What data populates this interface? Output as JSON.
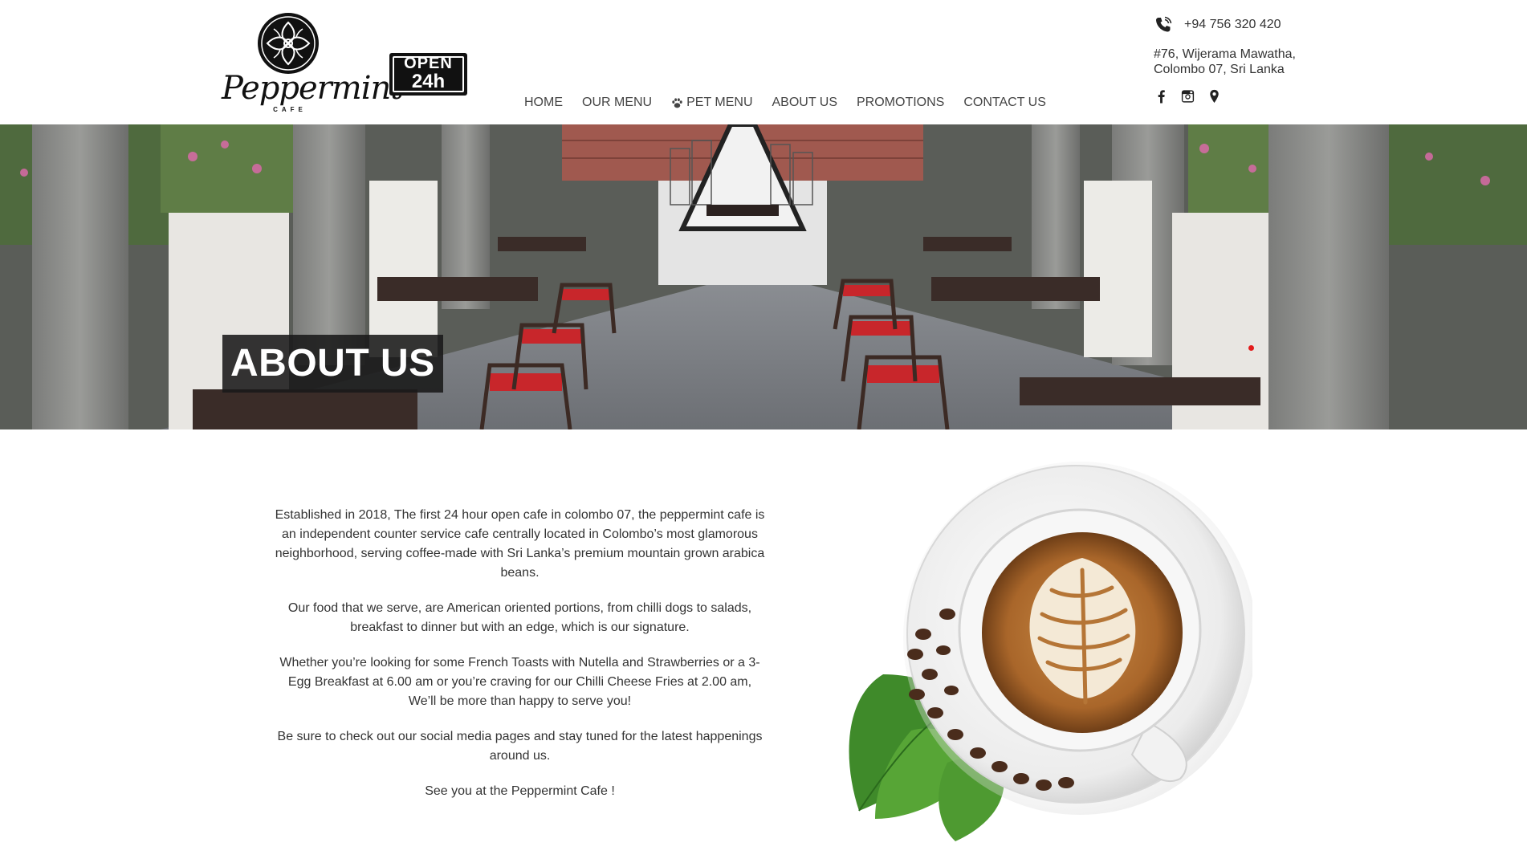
{
  "brand": {
    "name": "Peppermint",
    "subtitle": "CAFE",
    "badge_line1": "OPEN",
    "badge_line2": "24h"
  },
  "nav": {
    "items": [
      {
        "label": "HOME",
        "icon": null
      },
      {
        "label": "OUR MENU",
        "icon": null
      },
      {
        "label": "PET MENU",
        "icon": "paw-icon"
      },
      {
        "label": "ABOUT US",
        "icon": null
      },
      {
        "label": "PROMOTIONS",
        "icon": null
      },
      {
        "label": "CONTACT US",
        "icon": null
      }
    ]
  },
  "contact": {
    "phone": "+94 756 320 420",
    "address_line1": "#76, Wijerama Mawatha,",
    "address_line2": "Colombo 07, Sri Lanka",
    "socials": [
      "facebook-icon",
      "instagram-icon",
      "map-pin-icon"
    ]
  },
  "hero": {
    "title": "ABOUT US",
    "accent_color": "#e31b1b"
  },
  "about": {
    "paragraphs": [
      "Established in 2018, The first 24 hour open cafe in colombo 07, the peppermint cafe is an independent counter service cafe centrally located in Colombo’s most glamorous neighborhood, serving coffee-made with Sri Lanka’s premium mountain grown arabica beans.",
      "Our food that we serve, are American oriented portions, from chilli dogs to salads, breakfast to dinner but with an edge, which is our signature.",
      "Whether you’re looking for some French Toasts with Nutella and Strawberries or a 3-Egg Breakfast at 6.00 am or you’re craving for our Chilli Cheese Fries at 2.00 am, We’ll be more than happy to serve you!",
      "Be sure to check out our social media pages and stay tuned for the latest happenings around us.",
      "See you at the Peppermint Cafe !"
    ]
  }
}
